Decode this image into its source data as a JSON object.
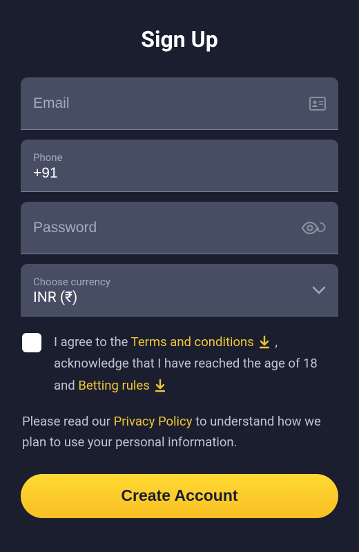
{
  "title": "Sign Up",
  "fields": {
    "email": {
      "placeholder": "Email"
    },
    "phone": {
      "label": "Phone",
      "value": "+91"
    },
    "password": {
      "placeholder": "Password"
    },
    "currency": {
      "label": "Choose currency",
      "value": "INR (₹)"
    }
  },
  "consent": {
    "prefix": "I agree to the ",
    "terms_link": "Terms and conditions",
    "mid1": " , acknowledge that I have reached the age of 18 and ",
    "betting_link": "Betting rules"
  },
  "privacy": {
    "prefix": "Please read our ",
    "link": "Privacy Policy",
    "suffix": " to understand how we plan to use your personal information."
  },
  "submit_label": "Create Account"
}
